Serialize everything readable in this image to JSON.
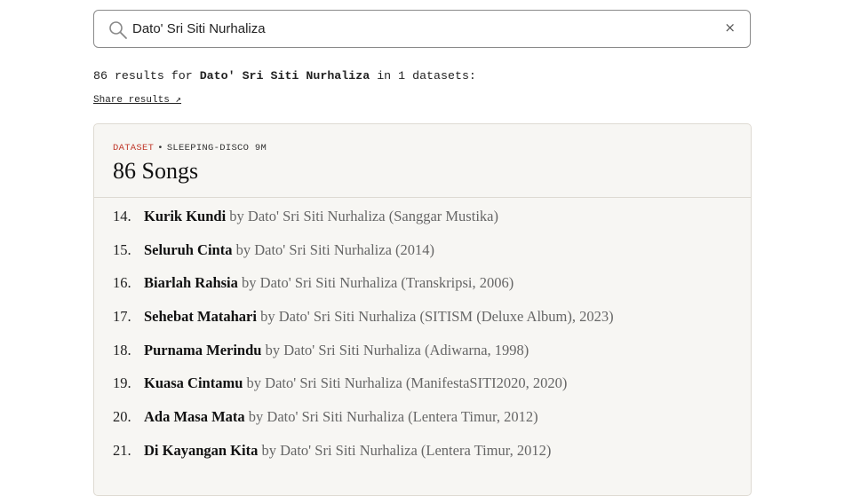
{
  "search": {
    "query": "Dato' Sri Siti Nurhaliza",
    "clear_label": "×"
  },
  "summary": {
    "prefix": "86 results for ",
    "query": "Dato' Sri Siti Nurhaliza",
    "suffix": " in 1 datasets:"
  },
  "share_label": "Share results ↗",
  "dataset": {
    "label": "DATASET",
    "separator": "•",
    "name": "SLEEPING-DISCO 9M",
    "title": "86 Songs",
    "label_color": "#c0392b"
  },
  "songs": [
    {
      "num": "14.",
      "title": "Kurik Kundi",
      "meta": "by Dato' Sri Siti Nurhaliza (Sanggar Mustika)"
    },
    {
      "num": "15.",
      "title": "Seluruh Cinta",
      "meta": "by Dato' Sri Siti Nurhaliza (2014)"
    },
    {
      "num": "16.",
      "title": "Biarlah Rahsia",
      "meta": "by Dato' Sri Siti Nurhaliza (Transkripsi, 2006)"
    },
    {
      "num": "17.",
      "title": "Sehebat Matahari",
      "meta": "by Dato' Sri Siti Nurhaliza (SITISM (Deluxe Album), 2023)"
    },
    {
      "num": "18.",
      "title": "Purnama Merindu",
      "meta": "by Dato' Sri Siti Nurhaliza (Adiwarna, 1998)"
    },
    {
      "num": "19.",
      "title": "Kuasa Cintamu",
      "meta": "by Dato' Sri Siti Nurhaliza (ManifestaSITI2020, 2020)"
    },
    {
      "num": "20.",
      "title": "Ada Masa Mata",
      "meta": "by Dato' Sri Siti Nurhaliza (Lentera Timur, 2012)"
    },
    {
      "num": "21.",
      "title": "Di Kayangan Kita",
      "meta": "by Dato' Sri Siti Nurhaliza (Lentera Timur, 2012)"
    }
  ]
}
